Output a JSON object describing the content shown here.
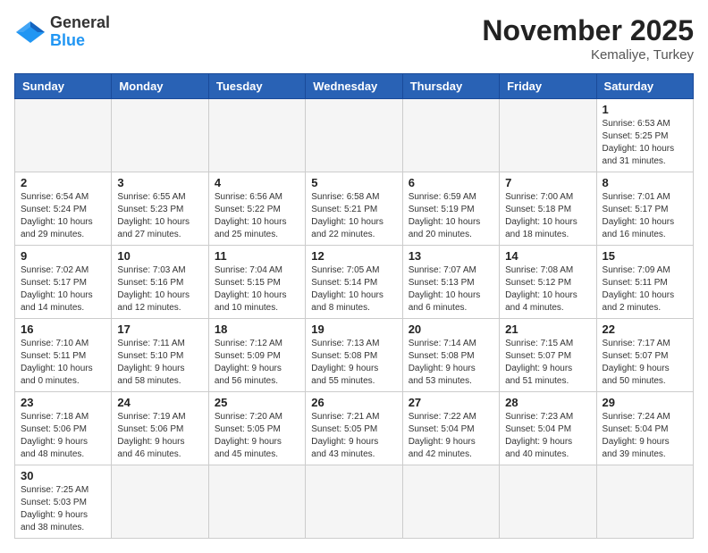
{
  "header": {
    "logo_general": "General",
    "logo_blue": "Blue",
    "month_title": "November 2025",
    "location": "Kemaliye, Turkey"
  },
  "days_of_week": [
    "Sunday",
    "Monday",
    "Tuesday",
    "Wednesday",
    "Thursday",
    "Friday",
    "Saturday"
  ],
  "weeks": [
    [
      {
        "day": "",
        "info": ""
      },
      {
        "day": "",
        "info": ""
      },
      {
        "day": "",
        "info": ""
      },
      {
        "day": "",
        "info": ""
      },
      {
        "day": "",
        "info": ""
      },
      {
        "day": "",
        "info": ""
      },
      {
        "day": "1",
        "info": "Sunrise: 6:53 AM\nSunset: 5:25 PM\nDaylight: 10 hours\nand 31 minutes."
      }
    ],
    [
      {
        "day": "2",
        "info": "Sunrise: 6:54 AM\nSunset: 5:24 PM\nDaylight: 10 hours\nand 29 minutes."
      },
      {
        "day": "3",
        "info": "Sunrise: 6:55 AM\nSunset: 5:23 PM\nDaylight: 10 hours\nand 27 minutes."
      },
      {
        "day": "4",
        "info": "Sunrise: 6:56 AM\nSunset: 5:22 PM\nDaylight: 10 hours\nand 25 minutes."
      },
      {
        "day": "5",
        "info": "Sunrise: 6:58 AM\nSunset: 5:21 PM\nDaylight: 10 hours\nand 22 minutes."
      },
      {
        "day": "6",
        "info": "Sunrise: 6:59 AM\nSunset: 5:19 PM\nDaylight: 10 hours\nand 20 minutes."
      },
      {
        "day": "7",
        "info": "Sunrise: 7:00 AM\nSunset: 5:18 PM\nDaylight: 10 hours\nand 18 minutes."
      },
      {
        "day": "8",
        "info": "Sunrise: 7:01 AM\nSunset: 5:17 PM\nDaylight: 10 hours\nand 16 minutes."
      }
    ],
    [
      {
        "day": "9",
        "info": "Sunrise: 7:02 AM\nSunset: 5:17 PM\nDaylight: 10 hours\nand 14 minutes."
      },
      {
        "day": "10",
        "info": "Sunrise: 7:03 AM\nSunset: 5:16 PM\nDaylight: 10 hours\nand 12 minutes."
      },
      {
        "day": "11",
        "info": "Sunrise: 7:04 AM\nSunset: 5:15 PM\nDaylight: 10 hours\nand 10 minutes."
      },
      {
        "day": "12",
        "info": "Sunrise: 7:05 AM\nSunset: 5:14 PM\nDaylight: 10 hours\nand 8 minutes."
      },
      {
        "day": "13",
        "info": "Sunrise: 7:07 AM\nSunset: 5:13 PM\nDaylight: 10 hours\nand 6 minutes."
      },
      {
        "day": "14",
        "info": "Sunrise: 7:08 AM\nSunset: 5:12 PM\nDaylight: 10 hours\nand 4 minutes."
      },
      {
        "day": "15",
        "info": "Sunrise: 7:09 AM\nSunset: 5:11 PM\nDaylight: 10 hours\nand 2 minutes."
      }
    ],
    [
      {
        "day": "16",
        "info": "Sunrise: 7:10 AM\nSunset: 5:11 PM\nDaylight: 10 hours\nand 0 minutes."
      },
      {
        "day": "17",
        "info": "Sunrise: 7:11 AM\nSunset: 5:10 PM\nDaylight: 9 hours\nand 58 minutes."
      },
      {
        "day": "18",
        "info": "Sunrise: 7:12 AM\nSunset: 5:09 PM\nDaylight: 9 hours\nand 56 minutes."
      },
      {
        "day": "19",
        "info": "Sunrise: 7:13 AM\nSunset: 5:08 PM\nDaylight: 9 hours\nand 55 minutes."
      },
      {
        "day": "20",
        "info": "Sunrise: 7:14 AM\nSunset: 5:08 PM\nDaylight: 9 hours\nand 53 minutes."
      },
      {
        "day": "21",
        "info": "Sunrise: 7:15 AM\nSunset: 5:07 PM\nDaylight: 9 hours\nand 51 minutes."
      },
      {
        "day": "22",
        "info": "Sunrise: 7:17 AM\nSunset: 5:07 PM\nDaylight: 9 hours\nand 50 minutes."
      }
    ],
    [
      {
        "day": "23",
        "info": "Sunrise: 7:18 AM\nSunset: 5:06 PM\nDaylight: 9 hours\nand 48 minutes."
      },
      {
        "day": "24",
        "info": "Sunrise: 7:19 AM\nSunset: 5:06 PM\nDaylight: 9 hours\nand 46 minutes."
      },
      {
        "day": "25",
        "info": "Sunrise: 7:20 AM\nSunset: 5:05 PM\nDaylight: 9 hours\nand 45 minutes."
      },
      {
        "day": "26",
        "info": "Sunrise: 7:21 AM\nSunset: 5:05 PM\nDaylight: 9 hours\nand 43 minutes."
      },
      {
        "day": "27",
        "info": "Sunrise: 7:22 AM\nSunset: 5:04 PM\nDaylight: 9 hours\nand 42 minutes."
      },
      {
        "day": "28",
        "info": "Sunrise: 7:23 AM\nSunset: 5:04 PM\nDaylight: 9 hours\nand 40 minutes."
      },
      {
        "day": "29",
        "info": "Sunrise: 7:24 AM\nSunset: 5:04 PM\nDaylight: 9 hours\nand 39 minutes."
      }
    ],
    [
      {
        "day": "30",
        "info": "Sunrise: 7:25 AM\nSunset: 5:03 PM\nDaylight: 9 hours\nand 38 minutes."
      },
      {
        "day": "",
        "info": ""
      },
      {
        "day": "",
        "info": ""
      },
      {
        "day": "",
        "info": ""
      },
      {
        "day": "",
        "info": ""
      },
      {
        "day": "",
        "info": ""
      },
      {
        "day": "",
        "info": ""
      }
    ]
  ]
}
